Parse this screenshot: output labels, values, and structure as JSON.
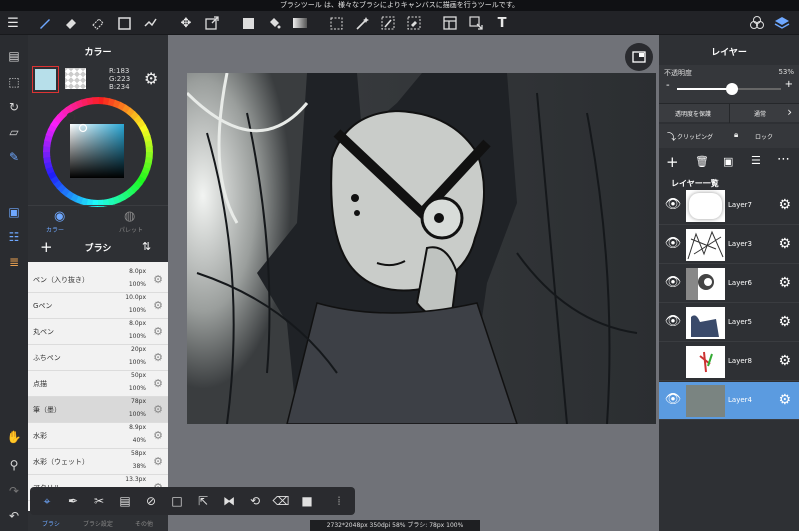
{
  "status_bar": {
    "hint": "ブラシツール は、様々なブラシによりキャンバスに描画を行うツールです。"
  },
  "toolbar": {
    "icons": [
      "menu-icon",
      "brush-icon",
      "eraser-icon",
      "blur-eraser-icon",
      "rect-shape-icon",
      "gradient-icon",
      "move-icon",
      "transform-icon",
      "fill-color-icon",
      "bucket-icon",
      "gradient-fill-icon",
      "select-rect-icon",
      "magic-wand-icon",
      "select-pen-icon",
      "select-eraser-icon",
      "layout-icon",
      "select-move-icon",
      "text-icon",
      "materials-icon",
      "layers-icon"
    ]
  },
  "color_panel": {
    "title": "カラー",
    "rgb_r": "R:183",
    "rgb_g": "G:223",
    "rgb_b": "B:234",
    "main_color": "#b7dfea",
    "tabs": {
      "color": "カラー",
      "palette": "パレット"
    }
  },
  "brush_panel": {
    "title": "ブラシ",
    "brushes": [
      {
        "name": "ペン（入り抜き）",
        "size": "8.0px",
        "opacity": "100%"
      },
      {
        "name": "Gペン",
        "size": "10.0px",
        "opacity": "100%"
      },
      {
        "name": "丸ペン",
        "size": "8.0px",
        "opacity": "100%"
      },
      {
        "name": "ふちペン",
        "size": "20px",
        "opacity": "100%"
      },
      {
        "name": "点描",
        "size": "50px",
        "opacity": "100%"
      },
      {
        "name": "筆（墨）",
        "size": "78px",
        "opacity": "100%"
      },
      {
        "name": "水彩",
        "size": "8.9px",
        "opacity": "40%"
      },
      {
        "name": "水彩（ウェット）",
        "size": "58px",
        "opacity": "38%"
      },
      {
        "name": "アクリル",
        "size": "13.3px",
        "opacity": ""
      }
    ],
    "selected_index": 5,
    "bottom_tabs": {
      "brush": "ブラシ",
      "brush_settings": "ブラシ設定",
      "other": "その他"
    }
  },
  "layer_panel": {
    "title": "レイヤー",
    "opacity_label": "不透明度",
    "opacity_value": "53%",
    "opacity_fraction": 0.53,
    "slider_minus": "-",
    "slider_plus": "+",
    "protect_alpha": "透明度を保護",
    "blend_mode": "通常",
    "clipping": "クリッピング",
    "lock": "ロック",
    "list_title": "レイヤー一覧",
    "layers": [
      {
        "name": "Layer7",
        "visible": true,
        "selected": false
      },
      {
        "name": "Layer3",
        "visible": true,
        "selected": false
      },
      {
        "name": "Layer6",
        "visible": true,
        "selected": false
      },
      {
        "name": "Layer5",
        "visible": true,
        "selected": false
      },
      {
        "name": "Layer8",
        "visible": false,
        "selected": false
      },
      {
        "name": "Layer4",
        "visible": true,
        "selected": true
      }
    ]
  },
  "status_line": {
    "text": "2732*2048px 350dpi 58% ブラシ: 78px 100%"
  },
  "colors": {
    "accent": "#4a8fd6",
    "selected_layer": "#5b9be0",
    "selected_brush": "#d9d9d9"
  }
}
